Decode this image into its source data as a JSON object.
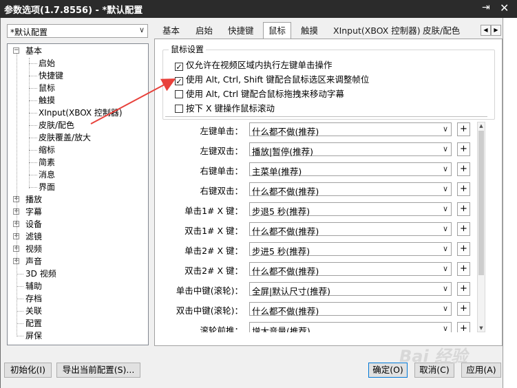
{
  "window": {
    "title": "参数选项(1.7.8556) - *默认配置",
    "pin": "⇥",
    "close": "✕"
  },
  "profile": {
    "value": "*默认配置"
  },
  "tree": {
    "root": "基本",
    "children": [
      "启始",
      "快捷键",
      "鼠标",
      "触摸",
      "XInput(XBOX 控制器)",
      "皮肤/配色",
      "皮肤覆盖/放大",
      "缩标",
      "简素",
      "消息",
      "界面"
    ],
    "groups": [
      "播放",
      "字幕",
      "设备",
      "滤镜",
      "视频",
      "声音"
    ],
    "leaves": [
      "3D 视频",
      "辅助",
      "存档",
      "关联",
      "配置",
      "屏保"
    ]
  },
  "tabs": [
    "基本",
    "启始",
    "快捷键",
    "鼠标",
    "触摸",
    "XInput(XBOX 控制器)",
    "皮肤/配色"
  ],
  "active_tab": "鼠标",
  "mouse": {
    "group_label": "鼠标设置",
    "options": [
      {
        "label": "仅允许在视频区域内执行左键单击操作",
        "checked": true
      },
      {
        "label": "使用 Alt, Ctrl, Shift 键配合鼠标选区来调整帧位",
        "checked": true
      },
      {
        "label": "使用 Alt, Ctrl 键配合鼠标拖拽来移动字幕",
        "checked": false
      },
      {
        "label": "按下 X 键操作鼠标滚动",
        "checked": false
      }
    ],
    "actions": [
      {
        "label": "左键单击：",
        "value": "什么都不做(推荐)"
      },
      {
        "label": "左键双击：",
        "value": "播放|暂停(推荐)"
      },
      {
        "label": "右键单击：",
        "value": "主菜单(推荐)"
      },
      {
        "label": "右键双击：",
        "value": "什么都不做(推荐)"
      },
      {
        "label": "单击1# X 键：",
        "value": "步退5 秒(推荐)"
      },
      {
        "label": "双击1# X 键：",
        "value": "什么都不做(推荐)"
      },
      {
        "label": "单击2# X 键：",
        "value": "步进5 秒(推荐)"
      },
      {
        "label": "双击2# X 键：",
        "value": "什么都不做(推荐)"
      },
      {
        "label": "单击中键(滚轮)：",
        "value": "全屏|默认尺寸(推荐)"
      },
      {
        "label": "双击中键(滚轮)：",
        "value": "什么都不做(推荐)"
      },
      {
        "label": "滚轮前推：",
        "value": "增大音量(推荐)"
      }
    ],
    "plus": "+"
  },
  "buttons": {
    "init": "初始化(I)",
    "export": "导出当前配置(S)...",
    "ok": "确定(O)",
    "cancel": "取消(C)",
    "apply": "应用(A)"
  },
  "watermark": "Bai 经验",
  "colors": {
    "titlebar": "#2b2b2b",
    "arrow": "#e8413b",
    "focus": "#0078d7"
  }
}
